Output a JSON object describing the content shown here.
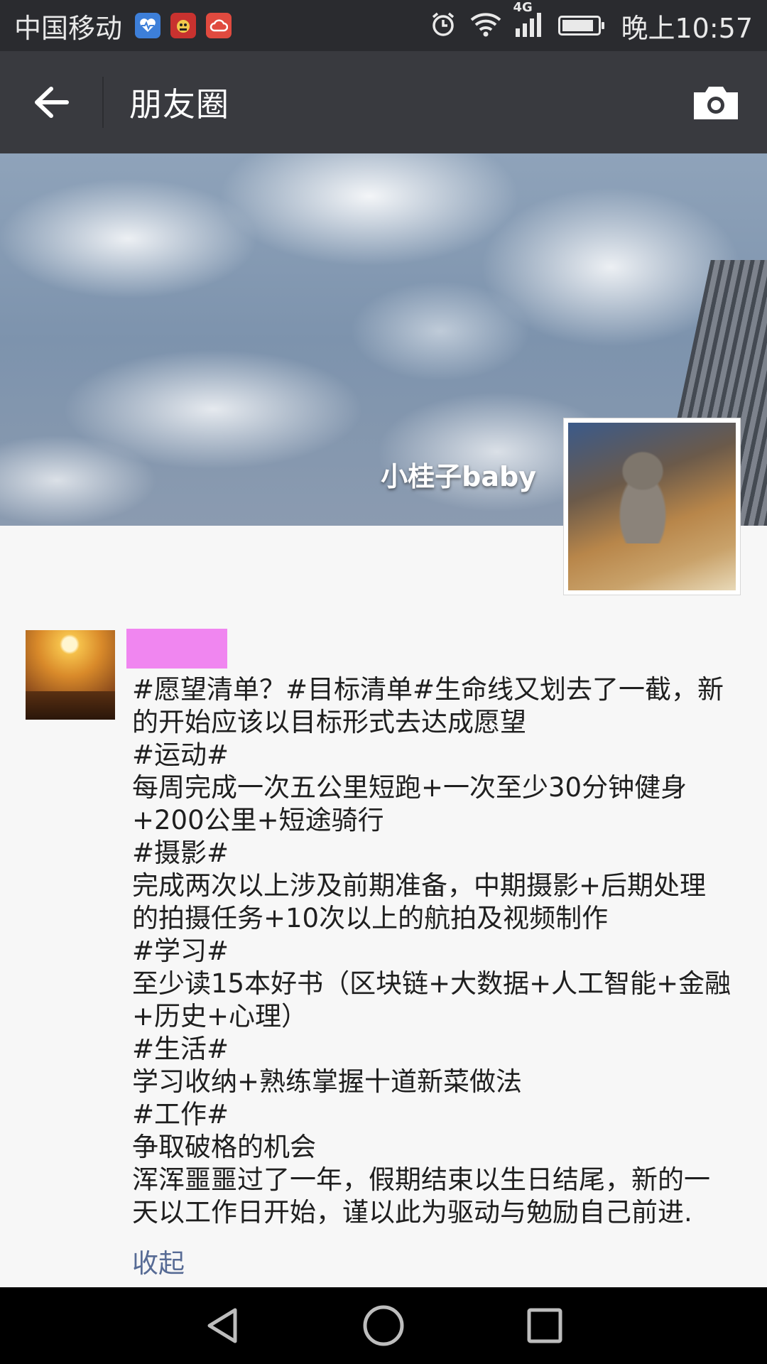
{
  "status_bar": {
    "carrier": "中国移动",
    "network": "4G",
    "time": "晚上10:57",
    "battery_level": 0.9,
    "icons": [
      "health-app-icon",
      "game-app-icon",
      "cloud-app-icon",
      "alarm-icon",
      "wifi-icon",
      "signal-icon",
      "battery-icon"
    ]
  },
  "nav": {
    "title": "朋友圈",
    "back_icon": "arrow-left-icon",
    "camera_icon": "camera-icon"
  },
  "cover": {
    "user_name": "小桂子baby"
  },
  "post": {
    "text_lines": [
      "#愿望清单？#目标清单#生命线又划去了一截，新",
      "的开始应该以目标形式去达成愿望",
      "#运动#",
      "每周完成一次五公里短跑+一次至少30分钟健身",
      "+200公里+短途骑行",
      "#摄影#",
      "完成两次以上涉及前期准备，中期摄影+后期处理",
      "的拍摄任务+10次以上的航拍及视频制作",
      "#学习#",
      "至少读15本好书（区块链+大数据+人工智能+金融",
      "+历史+心理）",
      "#生活#",
      "学习收纳+熟练掌握十道新菜做法",
      "#工作#",
      "争取破格的机会",
      "浑浑噩噩过了一年，假期结束以生日结尾，新的一",
      "天以工作日开始，谨以此为驱动与勉励自己前进."
    ],
    "collapse_label": "收起"
  },
  "system_nav": {
    "icons": [
      "back-triangle-icon",
      "home-circle-icon",
      "recents-square-icon"
    ]
  },
  "colors": {
    "status_bar": "#2a2b2f",
    "nav_bar": "#393a3f",
    "link": "#576b95",
    "name_redaction": "#f086f0"
  }
}
